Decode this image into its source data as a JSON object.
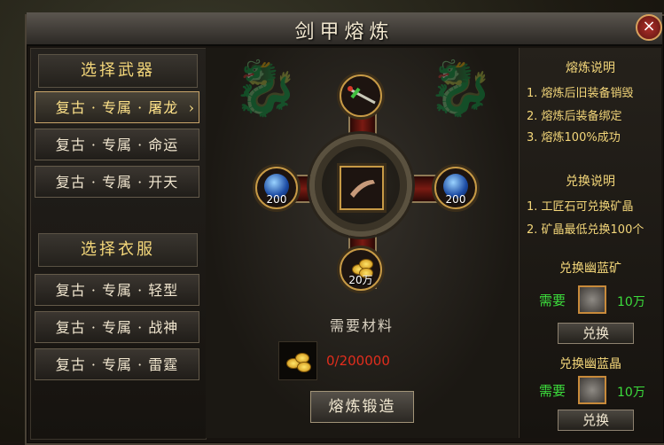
{
  "window": {
    "title": "剑甲熔炼",
    "close_icon": "×"
  },
  "left": {
    "weapon_header": "选择武器",
    "weapons": [
      {
        "label": "复古 · 专属 · 屠龙",
        "selected": true
      },
      {
        "label": "复古 · 专属 · 命运",
        "selected": false
      },
      {
        "label": "复古 · 专属 · 开天",
        "selected": false
      }
    ],
    "armor_header": "选择衣服",
    "armors": [
      {
        "label": "复古 · 专属 · 轻型"
      },
      {
        "label": "复古 · 专属 · 战神"
      },
      {
        "label": "复古 · 专属 · 雷霆"
      }
    ],
    "selected_arrow": "›"
  },
  "center": {
    "left_slot_count": "200",
    "right_slot_count": "200",
    "bottom_slot_count": "20万",
    "materials_label": "需要材料",
    "materials_progress": "0/200000",
    "forge_button": "熔炼锻造"
  },
  "right": {
    "rules_header": "熔炼说明",
    "rules": [
      "1. 熔炼后旧装备销毁",
      "2. 熔炼后装备绑定",
      "3. 熔炼100%成功"
    ],
    "exchange_header": "兑换说明",
    "exchange_rules": [
      "1. 工匠石可兑换矿晶",
      "2. 矿晶最低兑换100个"
    ],
    "exchange_items": [
      {
        "title": "兑换幽蓝矿",
        "need": "需要",
        "amount": "10万",
        "button": "兑换"
      },
      {
        "title": "兑换幽蓝晶",
        "need": "需要",
        "amount": "10万",
        "button": "兑换"
      }
    ]
  },
  "colors": {
    "accent": "#f4d77a",
    "need": "#3cdc3c",
    "warning": "#e12d1d"
  }
}
